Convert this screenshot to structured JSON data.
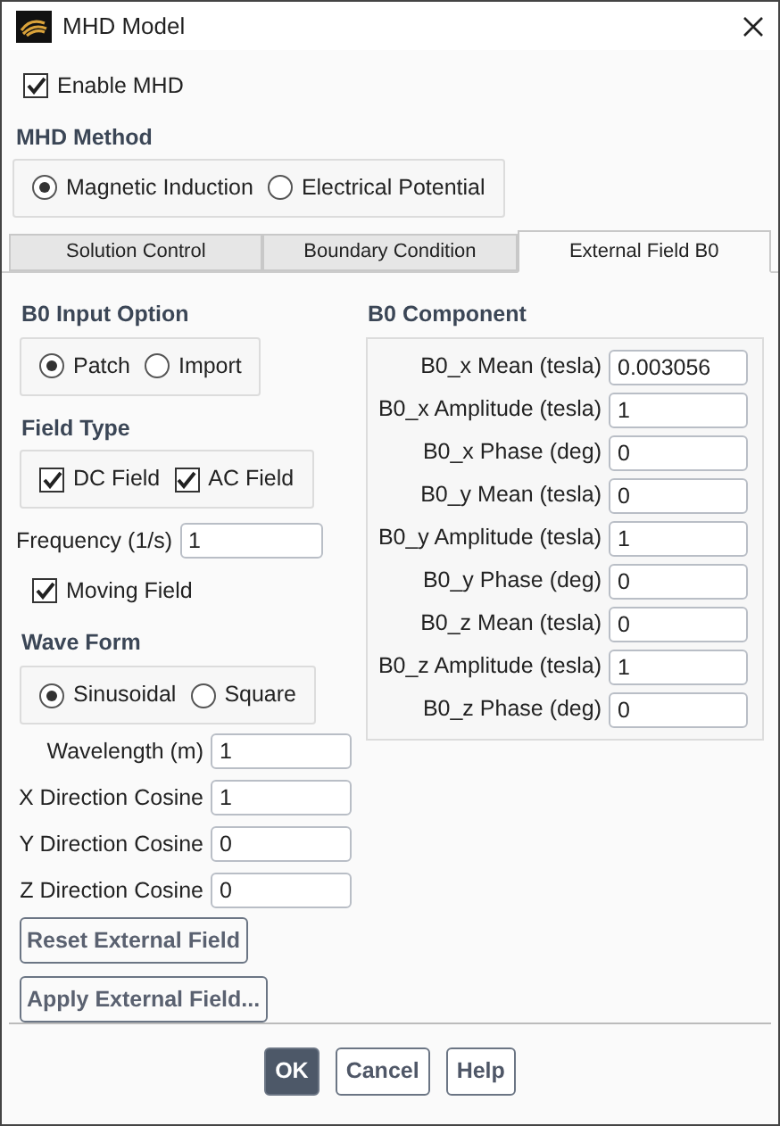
{
  "window": {
    "title": "MHD Model"
  },
  "enable_mhd": {
    "label": "Enable MHD",
    "checked": true
  },
  "mhd_method": {
    "title": "MHD Method",
    "options": [
      {
        "label": "Magnetic Induction",
        "selected": true
      },
      {
        "label": "Electrical Potential",
        "selected": false
      }
    ]
  },
  "tabs": [
    {
      "label": "Solution Control",
      "selected": false
    },
    {
      "label": "Boundary Condition",
      "selected": false
    },
    {
      "label": "External Field B0",
      "selected": true
    }
  ],
  "b0_input_option": {
    "title": "B0 Input Option",
    "options": [
      {
        "label": "Patch",
        "selected": true
      },
      {
        "label": "Import",
        "selected": false
      }
    ]
  },
  "field_type": {
    "title": "Field Type",
    "options": [
      {
        "label": "DC Field",
        "checked": true
      },
      {
        "label": "AC Field",
        "checked": true
      }
    ]
  },
  "frequency": {
    "label": "Frequency (1/s)",
    "value": "1"
  },
  "moving_field": {
    "label": "Moving Field",
    "checked": true
  },
  "wave_form": {
    "title": "Wave Form",
    "options": [
      {
        "label": "Sinusoidal",
        "selected": true
      },
      {
        "label": "Square",
        "selected": false
      }
    ]
  },
  "wave_fields": [
    {
      "label": "Wavelength (m)",
      "value": "1"
    },
    {
      "label": "X Direction Cosine",
      "value": "1"
    },
    {
      "label": "Y Direction Cosine",
      "value": "0"
    },
    {
      "label": "Z Direction Cosine",
      "value": "0"
    }
  ],
  "field_buttons": [
    "Reset External Field",
    "Apply External Field..."
  ],
  "b0_component": {
    "title": "B0 Component",
    "fields": [
      {
        "label": "B0_x Mean (tesla)",
        "value": "0.003056"
      },
      {
        "label": "B0_x Amplitude (tesla)",
        "value": "1"
      },
      {
        "label": "B0_x Phase (deg)",
        "value": "0"
      },
      {
        "label": "B0_y Mean (tesla)",
        "value": "0"
      },
      {
        "label": "B0_y Amplitude (tesla)",
        "value": "1"
      },
      {
        "label": "B0_y Phase (deg)",
        "value": "0"
      },
      {
        "label": "B0_z Mean (tesla)",
        "value": "0"
      },
      {
        "label": "B0_z Amplitude (tesla)",
        "value": "1"
      },
      {
        "label": "B0_z Phase (deg)",
        "value": "0"
      }
    ]
  },
  "buttons": [
    {
      "label": "OK",
      "default": true
    },
    {
      "label": "Cancel",
      "default": false
    },
    {
      "label": "Help",
      "default": false
    }
  ]
}
